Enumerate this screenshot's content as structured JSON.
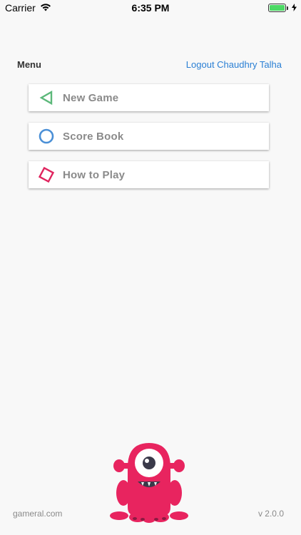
{
  "status_bar": {
    "carrier": "Carrier",
    "time": "6:35 PM"
  },
  "header": {
    "menu_title": "Menu",
    "logout_label": "Logout Chaudhry Talha"
  },
  "menu": {
    "items": [
      {
        "label": "New Game",
        "icon": "triangle-icon",
        "color": "#5cb87a"
      },
      {
        "label": "Score Book",
        "icon": "circle-icon",
        "color": "#4a8fd6"
      },
      {
        "label": "How to Play",
        "icon": "diamond-icon",
        "color": "#e0245e"
      }
    ]
  },
  "footer": {
    "site": "gameral.com",
    "version": "v 2.0.0"
  },
  "colors": {
    "background": "#f8f8f8",
    "link": "#2a7fd4",
    "mascot": "#e8245f"
  }
}
